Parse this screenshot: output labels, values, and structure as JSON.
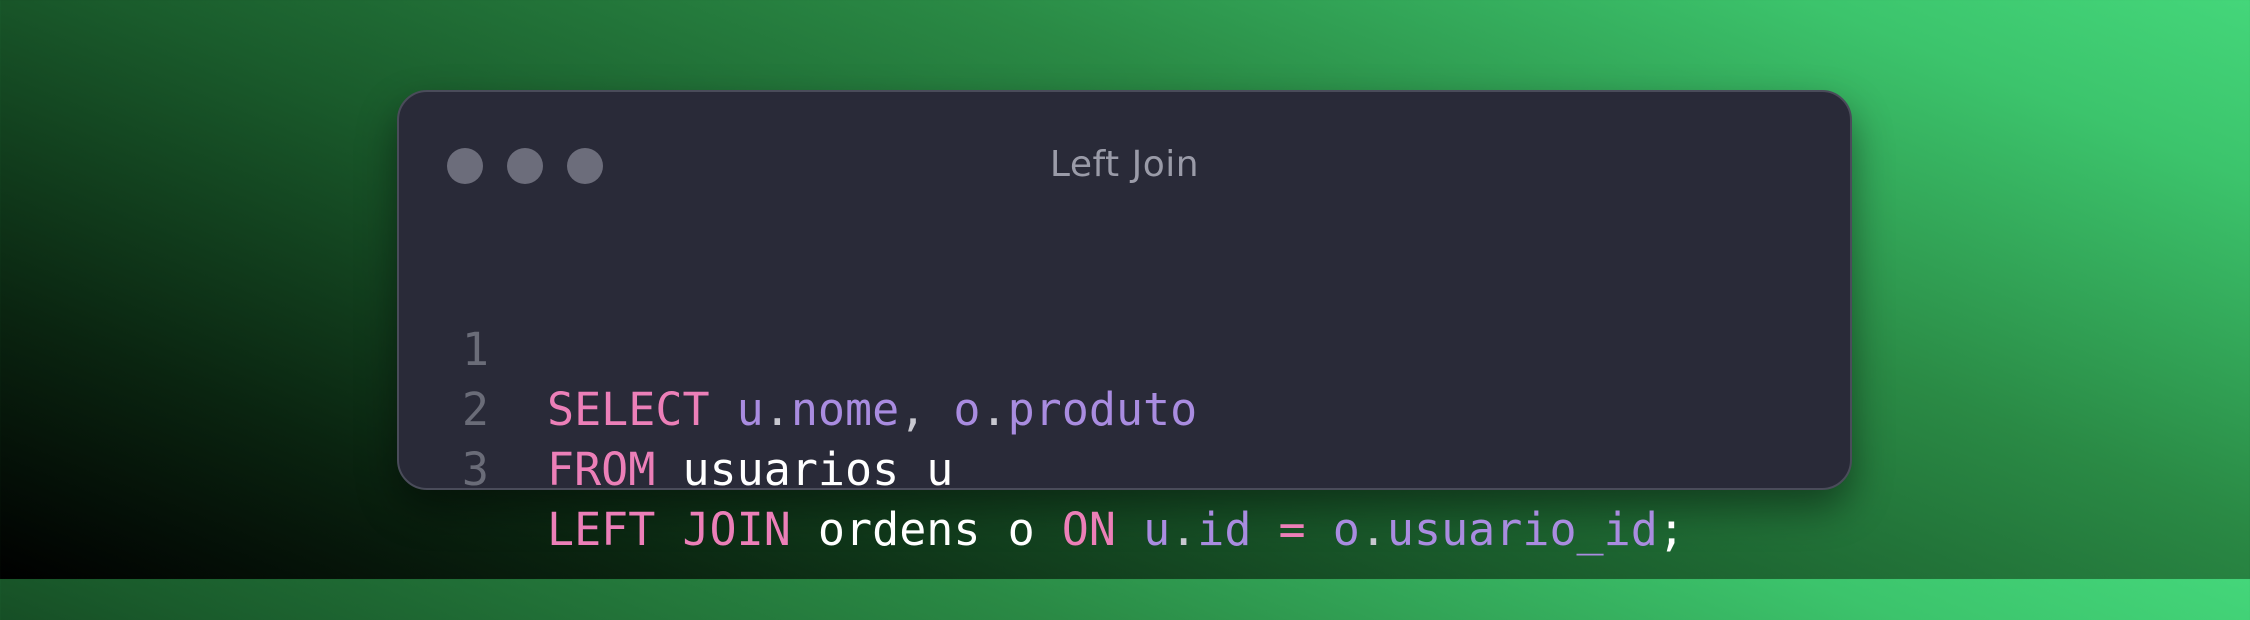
{
  "window": {
    "title": "Left Join"
  },
  "code": {
    "lines": [
      {
        "number": "1",
        "tokens": [
          {
            "text": "SELECT",
            "kind": "keyword"
          },
          {
            "text": " ",
            "kind": "plain"
          },
          {
            "text": "u",
            "kind": "identifier"
          },
          {
            "text": ".",
            "kind": "punct"
          },
          {
            "text": "nome",
            "kind": "identifier"
          },
          {
            "text": ", ",
            "kind": "punct"
          },
          {
            "text": "o",
            "kind": "identifier"
          },
          {
            "text": ".",
            "kind": "punct"
          },
          {
            "text": "produto",
            "kind": "identifier"
          }
        ]
      },
      {
        "number": "2",
        "tokens": [
          {
            "text": "FROM",
            "kind": "keyword"
          },
          {
            "text": " usuarios u",
            "kind": "plain"
          }
        ]
      },
      {
        "number": "3",
        "tokens": [
          {
            "text": "LEFT",
            "kind": "keyword"
          },
          {
            "text": " ",
            "kind": "plain"
          },
          {
            "text": "JOIN",
            "kind": "keyword"
          },
          {
            "text": " ordens o ",
            "kind": "plain"
          },
          {
            "text": "ON",
            "kind": "keyword"
          },
          {
            "text": " ",
            "kind": "plain"
          },
          {
            "text": "u",
            "kind": "identifier"
          },
          {
            "text": ".",
            "kind": "punct"
          },
          {
            "text": "id",
            "kind": "identifier"
          },
          {
            "text": " ",
            "kind": "plain"
          },
          {
            "text": "=",
            "kind": "keyword"
          },
          {
            "text": " ",
            "kind": "plain"
          },
          {
            "text": "o",
            "kind": "identifier"
          },
          {
            "text": ".",
            "kind": "punct"
          },
          {
            "text": "usuario_id",
            "kind": "identifier"
          },
          {
            "text": ";",
            "kind": "plain"
          }
        ]
      }
    ]
  },
  "colors": {
    "keyword": "#ec7fb8",
    "identifier": "#a98ce0",
    "plain": "#ffffff",
    "line_number": "#6a6c78",
    "window_bg": "#292a38"
  }
}
